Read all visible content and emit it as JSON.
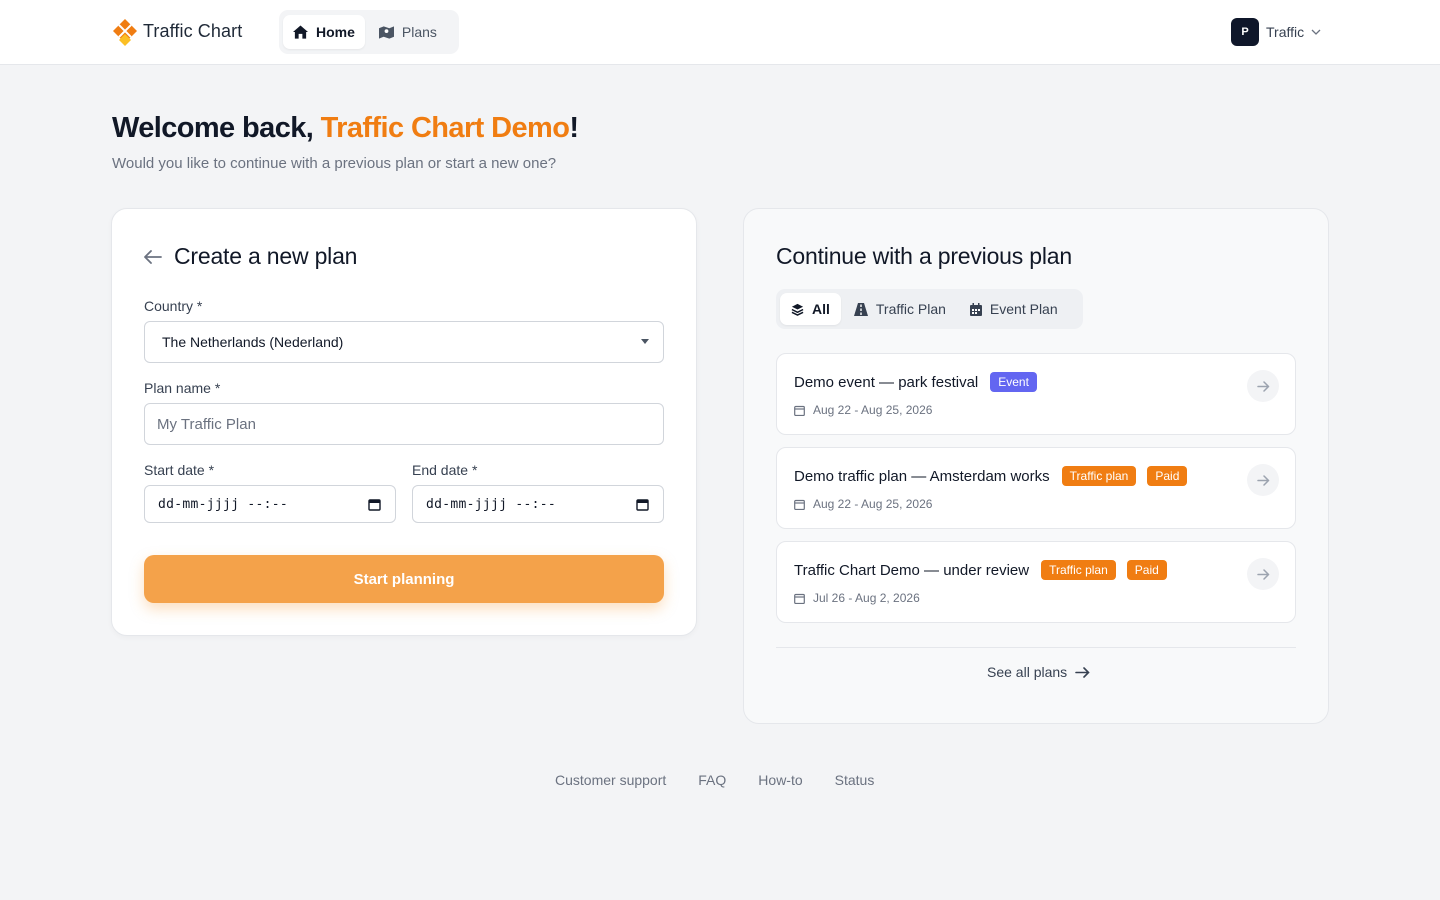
{
  "header": {
    "brand": "Traffic Chart",
    "nav": [
      {
        "label": "Home",
        "icon": "home-icon",
        "active": true
      },
      {
        "label": "Plans",
        "icon": "map-icon",
        "active": false
      }
    ],
    "user": {
      "initial": "P",
      "name": "Traffic"
    }
  },
  "welcome": {
    "prefix": "Welcome back, ",
    "name": "Traffic Chart Demo",
    "suffix": "!",
    "subtitle": "Would you like to continue with a previous plan or start a new one?"
  },
  "create": {
    "title": "Create a new plan",
    "country_label": "Country *",
    "country_value": "The Netherlands (Nederland)",
    "plan_name_label": "Plan name *",
    "plan_name_placeholder": "My Traffic Plan",
    "start_label": "Start date *",
    "start_value": "dd-mm-jjjj --:--",
    "end_label": "End date *",
    "end_value": "dd-mm-jjjj --:--",
    "submit": "Start planning"
  },
  "previous": {
    "title": "Continue with a previous plan",
    "filters": [
      {
        "label": "All",
        "active": true
      },
      {
        "label": "Traffic Plan",
        "active": false
      },
      {
        "label": "Event Plan",
        "active": false
      }
    ],
    "plans": [
      {
        "title": "Demo event — park festival",
        "badges": [
          "Event"
        ],
        "dates": "Aug 22 - Aug 25, 2026"
      },
      {
        "title": "Demo traffic plan — Amsterdam works",
        "badges": [
          "Traffic plan",
          "Paid"
        ],
        "dates": "Aug 22 - Aug 25, 2026"
      },
      {
        "title": "Traffic Chart Demo — under review",
        "badges": [
          "Traffic plan",
          "Paid"
        ],
        "dates": "Jul 26 - Aug 2, 2026"
      }
    ],
    "see_all": "See all plans"
  },
  "footer": {
    "links": [
      "Customer support",
      "FAQ",
      "How-to",
      "Status"
    ]
  },
  "colors": {
    "accent": "#f07d12",
    "button": "#f4a24a",
    "event_badge": "#6366f1",
    "avatar": "#0f172a"
  }
}
